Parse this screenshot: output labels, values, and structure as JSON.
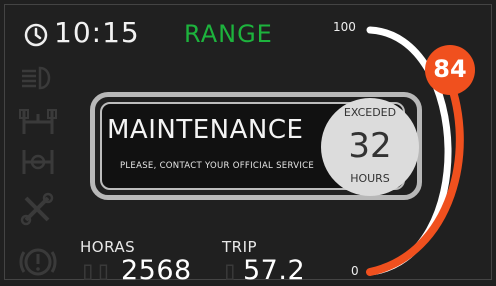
{
  "header": {
    "time": "10:15",
    "mode": "RANGE",
    "mode_color": "#1db33d",
    "clock_icon": "clock-icon"
  },
  "side_icons": [
    "headlight-icon",
    "axle-icon",
    "differential-lock-icon",
    "wrench-icon",
    "brake-warning-icon"
  ],
  "maintenance": {
    "title": "MAINTENANCE",
    "message": "PLEASE, CONTACT YOUR OFFICIAL SERVICE",
    "exceeded_label": "EXCEDED",
    "exceeded_value": "32",
    "exceeded_unit": "HOURS"
  },
  "gauge": {
    "max_label": "100",
    "min_label": "0",
    "value": "84",
    "level_percent": 84,
    "accent_color": "#f0501e"
  },
  "stats": {
    "hours_label": "HORAS",
    "hours_value": "2568",
    "trip_label": "TRIP",
    "trip_value": "57.2"
  }
}
